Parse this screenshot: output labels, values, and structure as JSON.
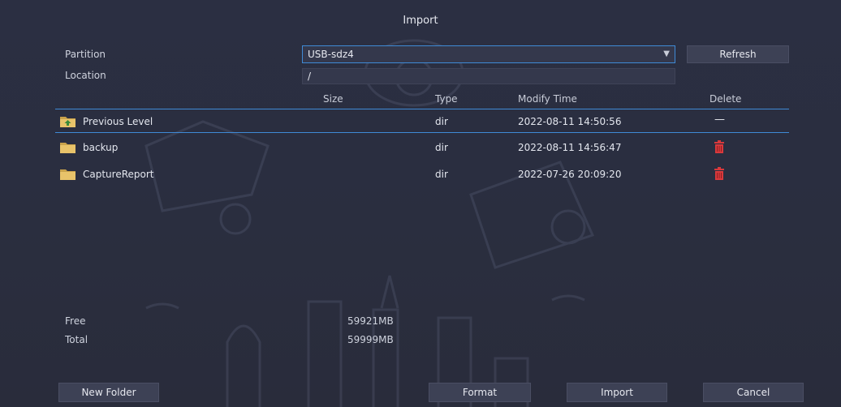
{
  "dialog": {
    "title": "Import"
  },
  "form": {
    "partition_label": "Partition",
    "partition_value": "USB-sdz4",
    "refresh_label": "Refresh",
    "location_label": "Location",
    "location_value": "/"
  },
  "table": {
    "columns": {
      "size": "Size",
      "type": "Type",
      "modify_time": "Modify Time",
      "delete": "Delete"
    },
    "rows": [
      {
        "name": "Previous Level",
        "type": "dir",
        "time": "2022-08-11 14:50:56",
        "delete": "—",
        "icon": "folder-up-icon"
      },
      {
        "name": "backup",
        "type": "dir",
        "time": "2022-08-11 14:56:47",
        "delete": "trash-icon",
        "icon": "folder-icon"
      },
      {
        "name": "CaptureReport",
        "type": "dir",
        "time": "2022-07-26 20:09:20",
        "delete": "trash-icon",
        "icon": "folder-icon"
      }
    ]
  },
  "storage": {
    "free_label": "Free",
    "free_value": "59921MB",
    "total_label": "Total",
    "total_value": "59999MB"
  },
  "buttons": {
    "new_folder": "New Folder",
    "format": "Format",
    "import": "Import",
    "cancel": "Cancel"
  },
  "colors": {
    "background": "#2a2e3f",
    "accent": "#3f8ad6",
    "delete": "#d9393c",
    "folder": "#e8c36a"
  }
}
